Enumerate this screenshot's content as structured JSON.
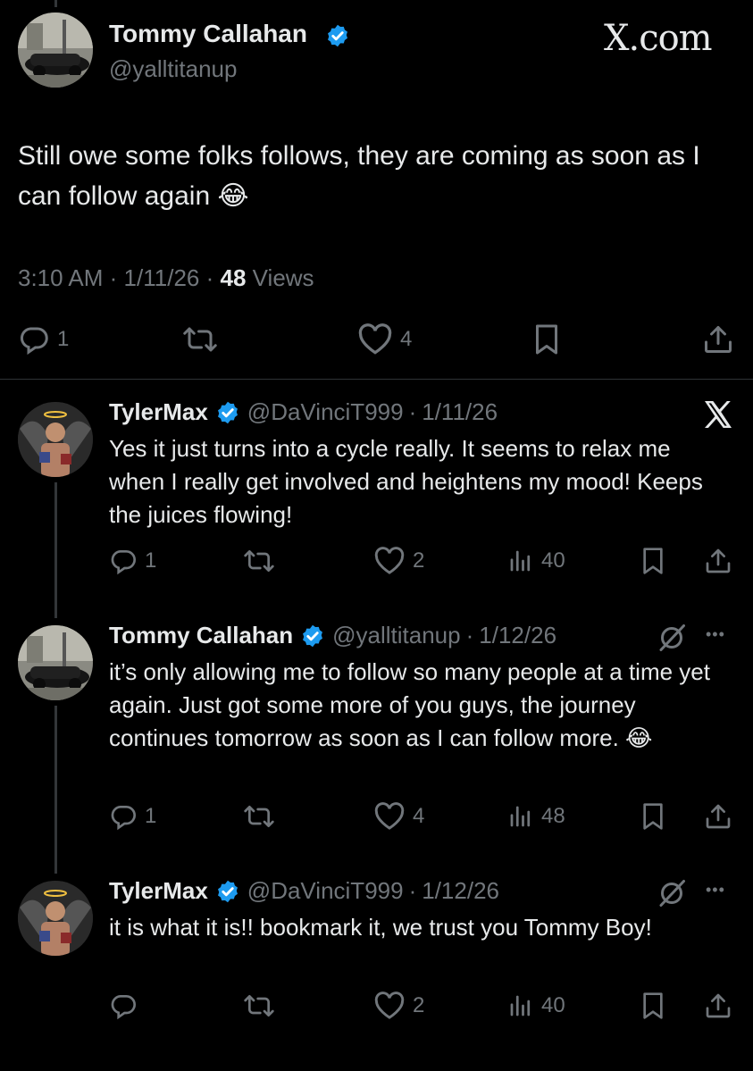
{
  "main_post": {
    "author_name": "Tommy Callahan",
    "handle": "@yalltitanup",
    "site": "X.com",
    "text": "Still owe some folks follows, they are coming as soon as I can follow again 😂",
    "time": "3:10 AM",
    "date": "1/11/26",
    "views_count": "48",
    "views_label": "Views",
    "replies": "1",
    "likes": "4"
  },
  "replies": [
    {
      "author_name": "TylerMax",
      "handle": "@DaVinciT999",
      "date": "1/11/26",
      "text": "Yes it just turns into a cycle really. It seems to relax me when I really get involved and heightens my mood! Keeps the juices flowing!",
      "replies": "1",
      "likes": "2",
      "views": "40"
    },
    {
      "author_name": "Tommy Callahan",
      "handle": "@yalltitanup",
      "date": "1/12/26",
      "text": "it’s only allowing me to follow so many people at a time yet again. Just got some more of you guys, the journey continues tomorrow as soon as I can follow more. 😂",
      "replies": "1",
      "likes": "4",
      "views": "48"
    },
    {
      "author_name": "TylerMax",
      "handle": "@DaVinciT999",
      "date": "1/12/26",
      "text": "it is what it is!! bookmark it, we trust you Tommy Boy!",
      "likes": "2",
      "views": "40"
    }
  ],
  "separator": "·",
  "more_label": "•••",
  "colors": {
    "background": "#000000",
    "text": "#e7e9ea",
    "muted": "#71767b",
    "verified": "#1d9bf0",
    "divider": "#2f3336"
  }
}
